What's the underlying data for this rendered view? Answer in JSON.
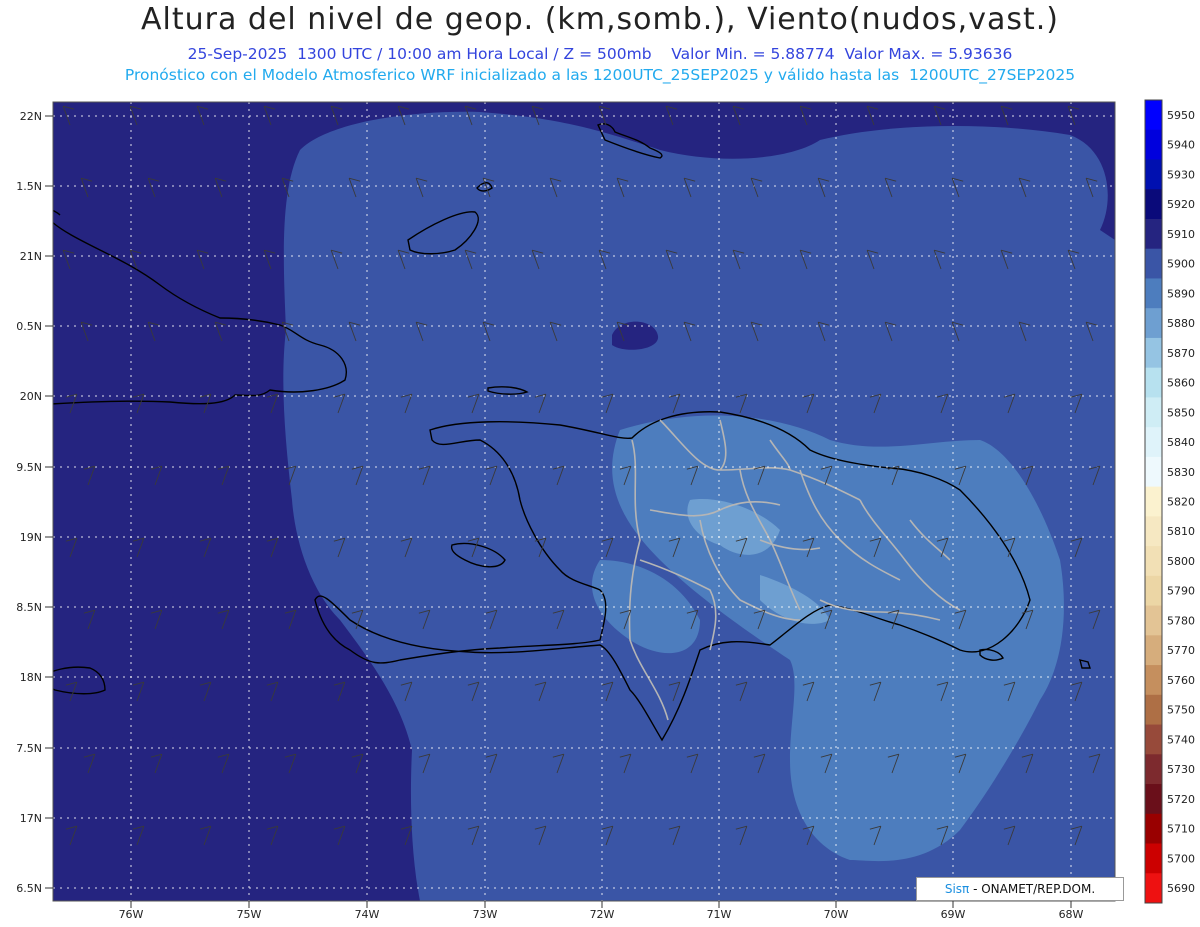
{
  "header": {
    "title": "Altura del nivel de geop. (km,somb.), Viento(nudos,vast.)",
    "subtitle1": "25-Sep-2025  1300 UTC / 10:00 am Hora Local / Z = 500mb    Valor Min. = 5.88774  Valor Max. = 5.93636",
    "subtitle2": "Pronóstico con el Modelo Atmosferico WRF inicializado a las 1200UTC_25SEP2025 y válido hasta las  1200UTC_27SEP2025"
  },
  "axes": {
    "lat_labels": [
      "22N",
      "1.5N",
      "21N",
      "0.5N",
      "20N",
      "9.5N",
      "19N",
      "8.5N",
      "18N",
      "7.5N",
      "17N",
      "6.5N"
    ],
    "lon_labels": [
      "76W",
      "75W",
      "74W",
      "73W",
      "72W",
      "71W",
      "70W",
      "69W",
      "68W"
    ]
  },
  "colorbar": {
    "levels": [
      "5950",
      "5940",
      "5930",
      "5920",
      "5910",
      "5900",
      "5890",
      "5880",
      "5870",
      "5860",
      "5850",
      "5840",
      "5830",
      "5820",
      "5810",
      "5800",
      "5790",
      "5780",
      "5770",
      "5760",
      "5750",
      "5740",
      "5730",
      "5720",
      "5710",
      "5700",
      "5690"
    ],
    "colors": [
      "#0000ff",
      "#0000dd",
      "#0010b0",
      "#0a0a7a",
      "#252480",
      "#3a55a6",
      "#4d7dbe",
      "#6e9fd1",
      "#95c4e3",
      "#b7e1ef",
      "#cfedf5",
      "#dff3fa",
      "#eef9fd",
      "#fbf2cf",
      "#f6e8c2",
      "#f2e0b5",
      "#ecd6a5",
      "#e3c495",
      "#d6ad7c",
      "#c58f5e",
      "#ae6f45",
      "#974a3a",
      "#7d2a2e",
      "#6a0f1a",
      "#990000",
      "#cc0000",
      "#ee1111"
    ]
  },
  "field_colors": {
    "outer": "#252480",
    "mid": "#3a55a6",
    "inner": "#4d7dbe",
    "core": "#6e9fd1"
  },
  "credit": {
    "sis": "Sisπ",
    "rest": " - ONAMET/REP.DOM."
  }
}
